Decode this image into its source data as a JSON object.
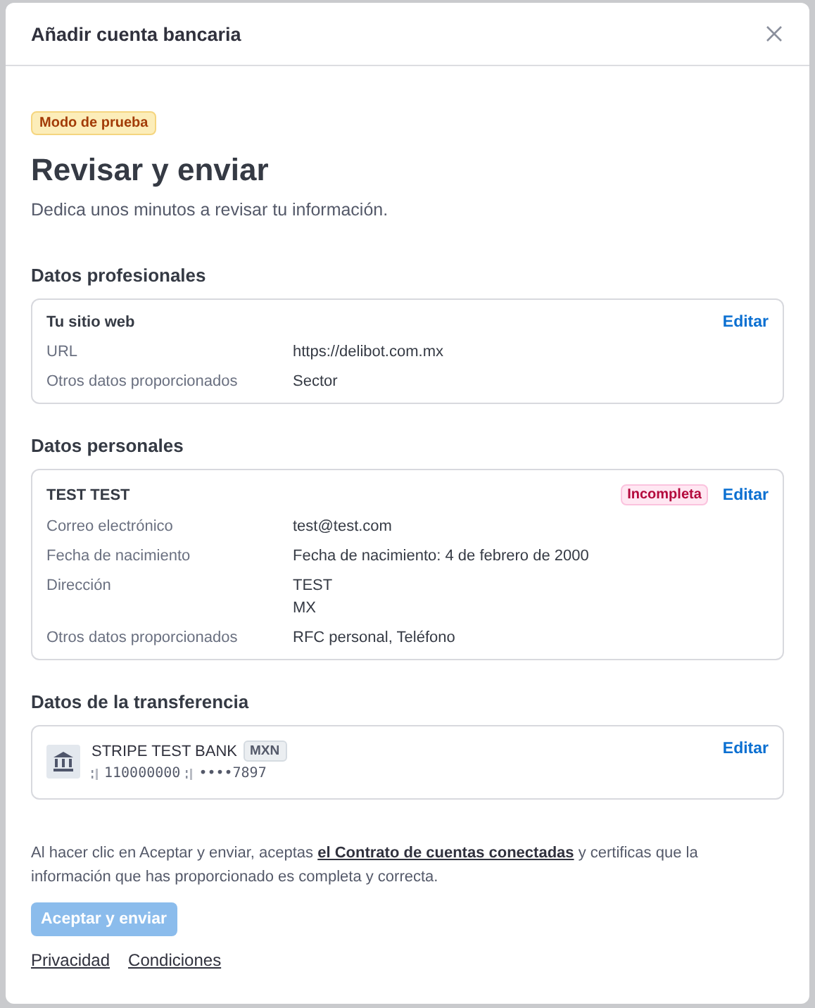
{
  "dialog": {
    "title": "Añadir cuenta bancaria"
  },
  "badge": "Modo de prueba",
  "heading": "Revisar y enviar",
  "subtitle": "Dedica unos minutos a revisar tu información.",
  "sections": [
    {
      "title": "Datos profesionales",
      "card": {
        "kind": "details",
        "name": "Tu sitio web",
        "edit": "Editar",
        "rows": [
          {
            "label": "URL",
            "values": [
              "https://delibot.com.mx"
            ]
          },
          {
            "label": "Otros datos proporcionados",
            "values": [
              "Sector"
            ]
          }
        ]
      }
    },
    {
      "title": "Datos personales",
      "card": {
        "kind": "details",
        "name": "TEST TEST",
        "status": "Incompleta",
        "edit": "Editar",
        "rows": [
          {
            "label": "Correo electrónico",
            "values": [
              "test@test.com"
            ]
          },
          {
            "label": "Fecha de nacimiento",
            "values": [
              "Fecha de nacimiento: 4 de febrero de 2000"
            ]
          },
          {
            "label": "Dirección",
            "values": [
              "TEST",
              "MX"
            ]
          },
          {
            "label": "Otros datos proporcionados",
            "values": [
              "RFC personal, Teléfono"
            ]
          }
        ]
      }
    },
    {
      "title": "Datos de la transferencia",
      "card": {
        "kind": "bank",
        "name": "STRIPE TEST BANK",
        "currency": "MXN",
        "routing": "110000000",
        "account": "••••7897",
        "edit": "Editar"
      }
    }
  ],
  "agreement": {
    "before": "Al hacer clic en Aceptar y enviar, aceptas ",
    "link": "el Contrato de cuentas conectadas",
    "after": " y certificas que la información que has proporcionado es completa y correcta."
  },
  "submit": {
    "label": "Aceptar y enviar",
    "disabled": true
  },
  "footer_links": [
    "Privacidad",
    "Condiciones"
  ]
}
